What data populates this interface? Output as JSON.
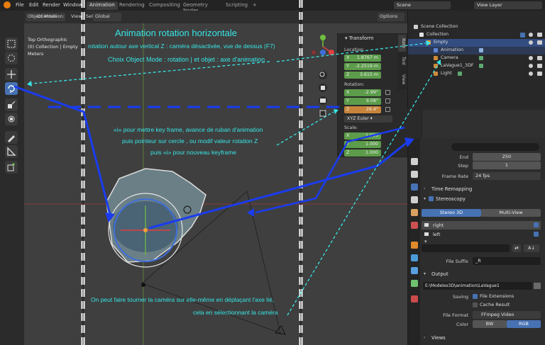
{
  "menu": {
    "items": [
      "File",
      "Edit",
      "Render",
      "Window"
    ]
  },
  "workspace_tabs": [
    "Animation",
    "Rendering",
    "Compositing",
    "Geometry Nodes",
    "Scripting"
  ],
  "add_tab_label": "+",
  "scene": {
    "label": "Scene",
    "view_layer": "View Layer"
  },
  "viewport_header": {
    "mode": "Object Mode",
    "view_menu": "View",
    "select_menu": "Sele",
    "orientation_label": "Orientation:",
    "transform_space": "Global",
    "options_label": "Options"
  },
  "viewport_info": {
    "line1": "Top Orthographic",
    "line2": "(0) Collection | Empty",
    "line3": "Meters"
  },
  "npanel": {
    "title": "Transform",
    "location_label": "Location:",
    "location": [
      {
        "axis": "X",
        "value": "1.8767 m"
      },
      {
        "axis": "Y",
        "value": "-2.2519 m"
      },
      {
        "axis": "Z",
        "value": "3.615 m"
      }
    ],
    "rotation_label": "Rotation:",
    "rotation": [
      {
        "axis": "X",
        "value": "-2.99°"
      },
      {
        "axis": "Y",
        "value": "9.08°"
      },
      {
        "axis": "Z",
        "value": "26.4°"
      }
    ],
    "rotation_mode": "XYZ Euler",
    "scale_label": "Scale:",
    "scale": [
      {
        "axis": "X",
        "value": "1.000"
      },
      {
        "axis": "Y",
        "value": "1.000"
      },
      {
        "axis": "Z",
        "value": "1.000"
      }
    ],
    "side_tabs": [
      "Item",
      "Tool",
      "View"
    ]
  },
  "outliner": {
    "rows": [
      {
        "label": "Scene Collection"
      },
      {
        "label": "Collection"
      },
      {
        "label": "Empty"
      },
      {
        "label": "Animation"
      },
      {
        "label": "Camera"
      },
      {
        "label": "LaVague1_3DF"
      },
      {
        "label": "Light"
      }
    ]
  },
  "properties": {
    "end_label": "End",
    "end_value": "250",
    "step_label": "Step",
    "step_value": "1",
    "frame_rate_label": "Frame Rate",
    "frame_rate_value": "24 fps",
    "time_remapping": "Time Remapping",
    "stereoscopy": "Stereoscopy",
    "stereo_3d": "Stereo 3D",
    "multi_view": "Multi-View",
    "view_right": "right",
    "view_left": "left",
    "file_suffix_label": "File Suffix",
    "file_suffix_value": "_R",
    "output": "Output",
    "output_path": "E:\\Modeles3D\\animation\\LaVague1",
    "saving_label": "Saving",
    "file_extensions": "File Extensions",
    "cache_result": "Cache Result",
    "file_format_label": "File Format",
    "file_format_value": "FFmpeg Video",
    "color_label": "Color",
    "color_bw": "BW",
    "color_rgb": "RGB",
    "views": "Views"
  },
  "annotations": {
    "title": "Animation rotation horizontale",
    "line2": "rotation autour axe vertical Z : caméra désactivée, vue de dessus (F7)",
    "line3": "Choix  Object Mode : rotation  |  et objet : axe d'animation",
    "keyframe1": "«i» pour mettre key frame, avance de ruban d'animation",
    "keyframe2": "puis pointeur sur cercle , ou modif valeur rotation Z",
    "keyframe3": "puis «i» pour nouveau keyframe",
    "camera1": "On peut faire tourner la caméra sur elle-même en déplaçant l'axe lié,",
    "camera2": "cela en sélectionnant la caméra"
  },
  "colors": {
    "accent_blue": "#4772b3",
    "annotation_cyan": "#38e6e6",
    "arrow_blue": "#1a3cf0",
    "field_green": "#5c9c4a",
    "field_orange": "#c8843b"
  }
}
